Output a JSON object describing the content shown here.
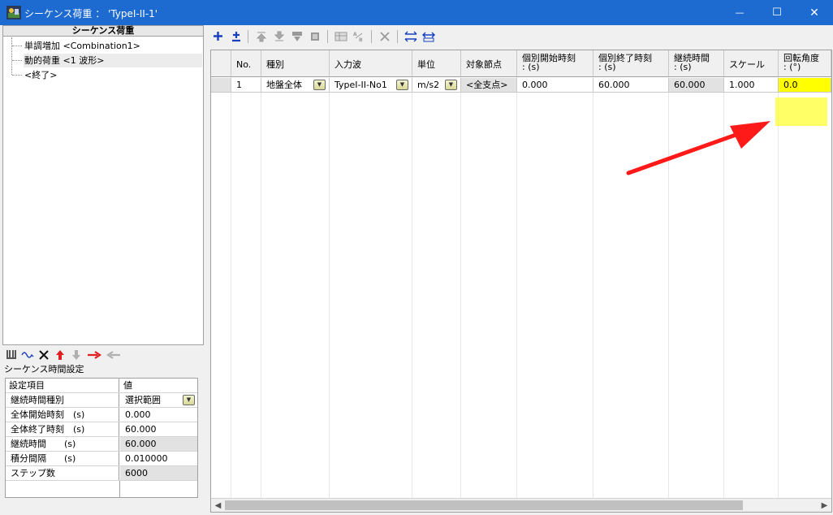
{
  "window": {
    "title": "シーケンス荷重 ： 'TypeI-II-1'",
    "minimize_glyph": "—",
    "maximize_glyph": "☐",
    "close_glyph": "✕"
  },
  "tree": {
    "header": "シーケンス荷重",
    "items": [
      {
        "label": "単調増加 <Combination1>"
      },
      {
        "label": "動的荷重 <1 波形>"
      },
      {
        "label": "<終了>"
      }
    ]
  },
  "left_toolbar": {
    "icons": [
      "insert-down-icon",
      "wave-icon",
      "delete-icon",
      "move-up-icon",
      "move-down-icon",
      "move-right-icon",
      "move-left-icon"
    ]
  },
  "sequence_time": {
    "label": "シーケンス時間設定",
    "header_key": "設定項目",
    "header_value": "値",
    "rows": [
      {
        "key": "継続時間種別",
        "value": "選択範囲"
      },
      {
        "key": "全体開始時刻　(s)",
        "value": "0.000"
      },
      {
        "key": "全体終了時刻　(s)",
        "value": "60.000"
      },
      {
        "key": "継続時間　　(s)",
        "value": "60.000"
      },
      {
        "key": "積分間隔　　(s)",
        "value": "0.010000"
      },
      {
        "key": "ステップ数",
        "value": "6000"
      }
    ]
  },
  "right_toolbar": {
    "icons": [
      "add-icon",
      "insert-icon",
      "move-top-icon",
      "move-bottom-icon",
      "fill-down-icon",
      "copy-icon",
      "table-icon",
      "sort-icon",
      "delete-icon",
      "expand-horizontal-icon",
      "fit-columns-icon"
    ]
  },
  "grid": {
    "columns": [
      {
        "line1": "No.",
        "line2": ""
      },
      {
        "line1": "種別",
        "line2": ""
      },
      {
        "line1": "入力波",
        "line2": ""
      },
      {
        "line1": "単位",
        "line2": ""
      },
      {
        "line1": "対象節点",
        "line2": ""
      },
      {
        "line1": "個別開始時刻",
        "line2": ": (s)"
      },
      {
        "line1": "個別終了時刻",
        "line2": ": (s)"
      },
      {
        "line1": "継続時間",
        "line2": ": (s)"
      },
      {
        "line1": "スケール",
        "line2": ""
      },
      {
        "line1": "回転角度",
        "line2": ": (°)"
      }
    ],
    "row": {
      "no": "1",
      "type": "地盤全体",
      "wave": "TypeI-II-No1",
      "unit": "m/s2",
      "node": "<全支点>",
      "start": "0.000",
      "end": "60.000",
      "duration": "60.000",
      "scale": "1.000",
      "angle": "0.0"
    }
  },
  "colors": {
    "titlebar": "#1d6ad0",
    "highlight": "#ffff00",
    "arrow": "#ff1a1a"
  }
}
